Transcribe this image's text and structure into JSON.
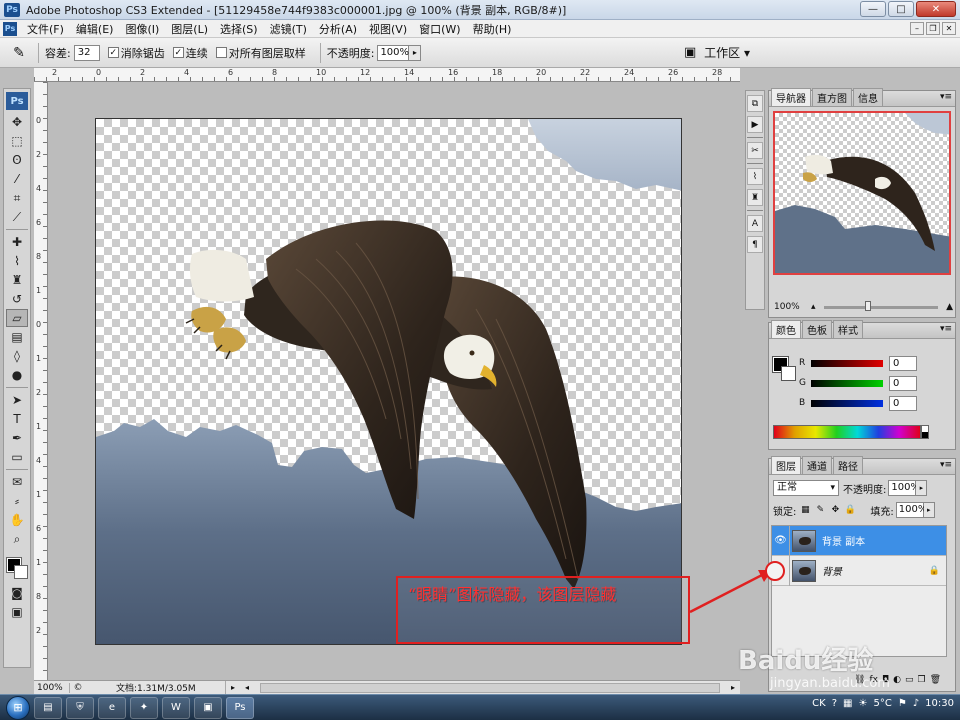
{
  "window": {
    "title": "Adobe Photoshop CS3 Extended - [51129458e744f9383c000001.jpg @ 100% (背景 副本, RGB/8#)]",
    "app_badge": "Ps",
    "minimize": "—",
    "maximize": "□",
    "close": "✕"
  },
  "menu": {
    "items": [
      "文件(F)",
      "编辑(E)",
      "图像(I)",
      "图层(L)",
      "选择(S)",
      "滤镜(T)",
      "分析(A)",
      "视图(V)",
      "窗口(W)",
      "帮助(H)"
    ]
  },
  "options": {
    "tolerance_label": "容差:",
    "tolerance_value": "32",
    "antialias_label": "消除锯齿",
    "antialias_checked": true,
    "contiguous_label": "连续",
    "contiguous_checked": true,
    "sample_all_label": "对所有图层取样",
    "sample_all_checked": false,
    "opacity_label": "不透明度:",
    "opacity_value": "100%",
    "workspace_label": "工作区"
  },
  "toolbox": {
    "badge": "Ps",
    "tools": [
      "move-tool",
      "marquee-tool",
      "lasso-tool",
      "magic-wand-tool",
      "crop-tool",
      "slice-tool",
      "healing-tool",
      "brush-tool",
      "stamp-tool",
      "history-brush-tool",
      "eraser-tool",
      "gradient-tool",
      "blur-tool",
      "dodge-tool",
      "path-select-tool",
      "type-tool",
      "pen-tool",
      "shape-tool",
      "notes-tool",
      "eyedropper-tool",
      "hand-tool",
      "zoom-tool"
    ],
    "active_tool": "eraser-tool",
    "foreground_color": "#000000",
    "background_color": "#ffffff"
  },
  "rulers": {
    "top_labels": [
      "2",
      "0",
      "2",
      "4",
      "6",
      "8",
      "10",
      "12",
      "14",
      "16",
      "18",
      "20",
      "22",
      "24",
      "26",
      "28"
    ],
    "left_labels": [
      "0",
      "2",
      "4",
      "6",
      "8",
      "1",
      "0",
      "1",
      "2",
      "1",
      "4",
      "1",
      "6",
      "1",
      "8",
      "2"
    ]
  },
  "annotation": {
    "text": "“眼睛”图标隐藏，该图层隐藏",
    "color": "#e02020"
  },
  "statusbar": {
    "zoom": "100%",
    "doc_info": "文档:1.31M/3.05M"
  },
  "navigator": {
    "tabs": [
      "导航器",
      "直方图",
      "信息"
    ],
    "zoom": "100%"
  },
  "color_panel": {
    "tabs": [
      "颜色",
      "色板",
      "样式"
    ],
    "channels": [
      {
        "label": "R",
        "value": "0",
        "color": "#d00000"
      },
      {
        "label": "G",
        "value": "0",
        "color": "#00b000"
      },
      {
        "label": "B",
        "value": "0",
        "color": "#0020d0"
      }
    ]
  },
  "layers_panel": {
    "tabs": [
      "图层",
      "通道",
      "路径"
    ],
    "blend_mode": "正常",
    "opacity_label": "不透明度:",
    "opacity_value": "100%",
    "lock_label": "锁定:",
    "fill_label": "填充:",
    "fill_value": "100%",
    "layers": [
      {
        "name": "背景 副本",
        "visible": true,
        "selected": true,
        "locked": false
      },
      {
        "name": "背景",
        "visible": false,
        "selected": false,
        "locked": true
      }
    ]
  },
  "taskbar": {
    "apps": [
      "explorer",
      "shield",
      "ie",
      "app4",
      "word",
      "folder",
      "photoshop"
    ],
    "active_app": "photoshop",
    "lang": "CK",
    "weather": "5°C",
    "time": "10:30"
  },
  "watermark": {
    "main": "Baidu经验",
    "sub": "jingyan.baidu.com"
  }
}
